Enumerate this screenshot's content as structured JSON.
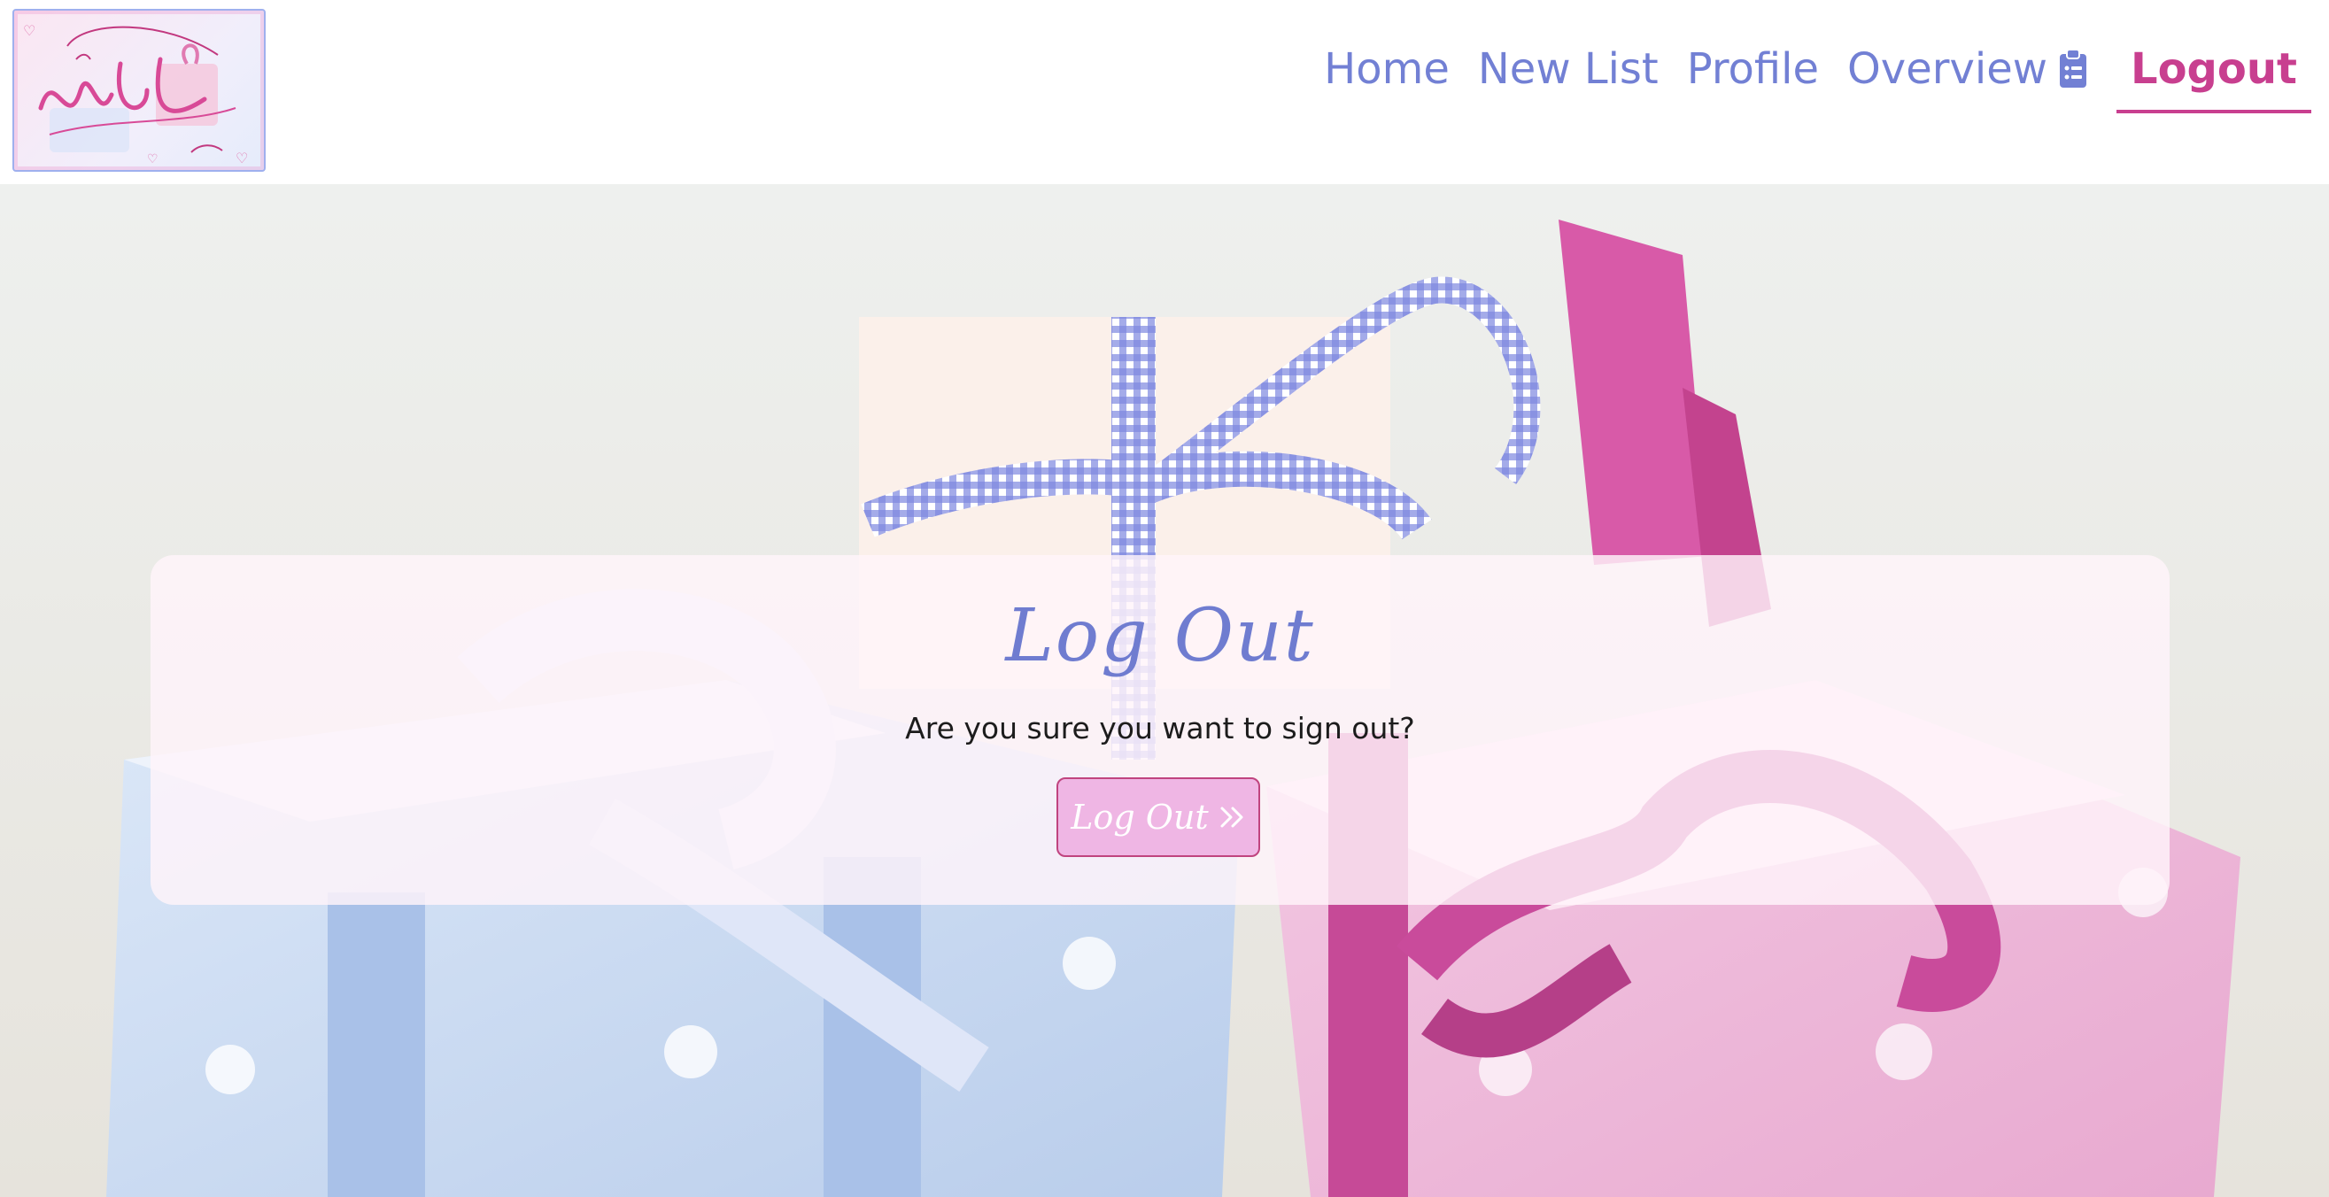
{
  "brand": {
    "logo_text": "Your Wish List Maker",
    "logo_icon": "wish-list-logo"
  },
  "nav": {
    "items": [
      {
        "label": "Home",
        "active": false
      },
      {
        "label": "New List",
        "active": false
      },
      {
        "label": "Profile",
        "active": false
      },
      {
        "label": "Overview",
        "active": false,
        "icon": "clipboard-list-icon"
      },
      {
        "label": "Logout",
        "active": true
      }
    ]
  },
  "card": {
    "title": "Log Out",
    "question": "Are you sure you want to sign out?",
    "button_label": "Log Out",
    "button_icon": "double-chevron-right-icon"
  },
  "colors": {
    "nav_text": "#7280d4",
    "nav_active": "#c83f8f",
    "title": "#6f7cd0",
    "button_bg": "#efb6e4",
    "button_border": "#c0447f"
  }
}
